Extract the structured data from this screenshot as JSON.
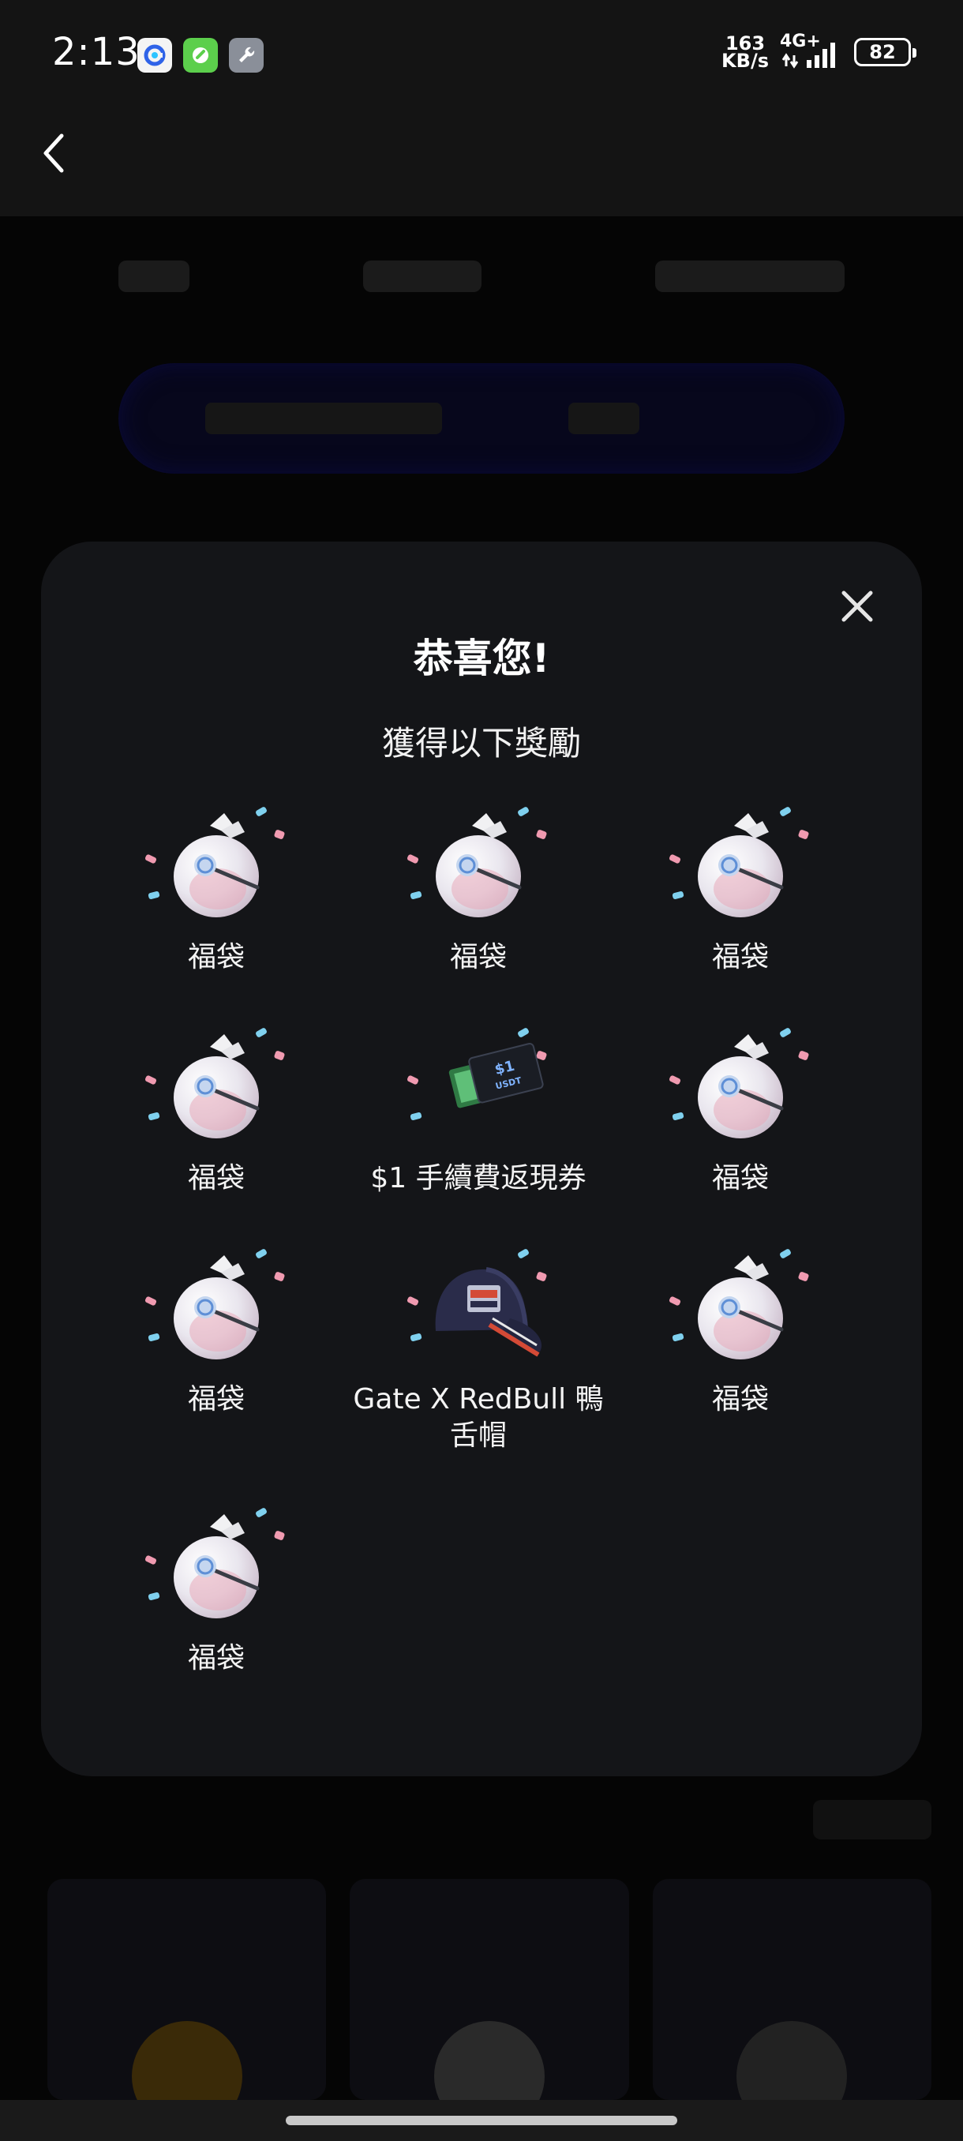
{
  "status_bar": {
    "time": "2:13",
    "net_speed_value": "163",
    "net_speed_unit": "KB/s",
    "network": "4G+",
    "battery": "82"
  },
  "dialog": {
    "title": "恭喜您!",
    "subtitle": "獲得以下獎勵",
    "rewards": [
      {
        "label": "福袋",
        "icon": "lucky-bag"
      },
      {
        "label": "福袋",
        "icon": "lucky-bag"
      },
      {
        "label": "福袋",
        "icon": "lucky-bag"
      },
      {
        "label": "福袋",
        "icon": "lucky-bag"
      },
      {
        "label": "$1 手續費返現券",
        "icon": "fee-rebate-voucher"
      },
      {
        "label": "福袋",
        "icon": "lucky-bag"
      },
      {
        "label": "福袋",
        "icon": "lucky-bag"
      },
      {
        "label": "Gate X RedBull 鴨舌帽",
        "icon": "cap"
      },
      {
        "label": "福袋",
        "icon": "lucky-bag"
      },
      {
        "label": "福袋",
        "icon": "lucky-bag"
      }
    ],
    "voucher_amount": "$1",
    "voucher_currency": "USDT"
  },
  "colors": {
    "dialog_bg": "#141518",
    "page_bg": "#050505",
    "confetti_blue": "#7fd0ee",
    "confetti_pink": "#f09ab0",
    "bag_fill": "#e9e6ee"
  }
}
